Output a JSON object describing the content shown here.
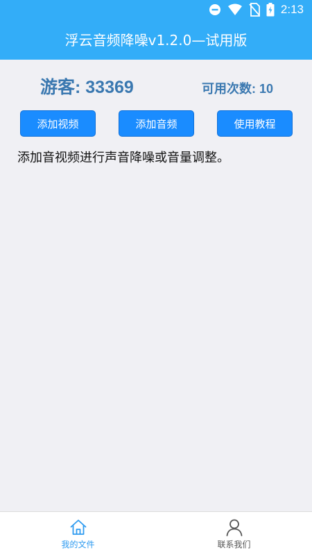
{
  "status_bar": {
    "time": "2:13",
    "icons": [
      "do-not-disturb-icon",
      "wifi-icon",
      "no-sim-icon",
      "battery-charging-icon"
    ]
  },
  "header": {
    "title": "浮云音频降噪v1.2.0—试用版",
    "background": "#33adf8"
  },
  "user": {
    "guest_label": "游客: 33369",
    "uses_label": "可用次数: 10",
    "text_color": "#3a78b0"
  },
  "actions": {
    "add_video": "添加视频",
    "add_audio": "添加音频",
    "tutorial": "使用教程",
    "button_color": "#1a8cff"
  },
  "main": {
    "description": "添加音视频进行声音降噪或音量调整。"
  },
  "bottom_nav": {
    "items": [
      {
        "label": "我的文件",
        "icon": "home-icon",
        "active": true
      },
      {
        "label": "联系我们",
        "icon": "person-icon",
        "active": false
      }
    ],
    "active_color": "#2e9bf0"
  }
}
